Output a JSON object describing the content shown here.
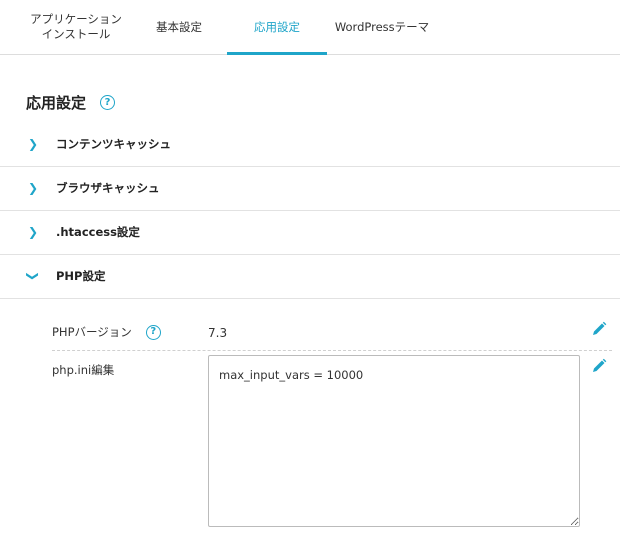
{
  "tabs": [
    {
      "line1": "アプリケーション",
      "line2": "インストール"
    },
    {
      "label": "基本設定"
    },
    {
      "label": "応用設定"
    },
    {
      "label": "WordPressテーマ"
    }
  ],
  "section": {
    "title": "応用設定",
    "help": "?"
  },
  "accordion": [
    {
      "label": "コンテンツキャッシュ",
      "chevron": "❯"
    },
    {
      "label": "ブラウザキャッシュ",
      "chevron": "❯"
    },
    {
      "label": ".htaccess設定",
      "chevron": "❯"
    },
    {
      "label": "PHP設定",
      "chevron": "❯"
    }
  ],
  "php": {
    "version_label": "PHPバージョン",
    "version_help": "?",
    "version_value": "7.3",
    "ini_label": "php.ini編集",
    "ini_value": "max_input_vars = 10000"
  },
  "colors": {
    "accent": "#1fa5c9"
  }
}
